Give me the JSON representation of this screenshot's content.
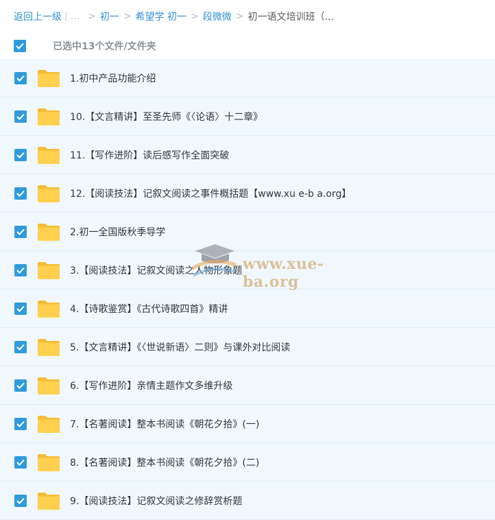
{
  "breadcrumb": {
    "back": "返回上一级",
    "ellipsis": "...",
    "items": [
      "初一",
      "希望学 初一",
      "段微微"
    ],
    "current": "初一语文培训班（..."
  },
  "selection": {
    "label": "已选中13个文件/文件夹"
  },
  "files": [
    {
      "name": "1.初中产品功能介绍"
    },
    {
      "name": "10.【文言精讲】至圣先师《〈论语〉十二章》"
    },
    {
      "name": "11.【写作进阶】读后感写作全面突破"
    },
    {
      "name": "12.【阅读技法】记叙文阅读之事件概括题【www.xu e-b a.org】"
    },
    {
      "name": "2.初一全国版秋季导学"
    },
    {
      "name": "3.【阅读技法】记叙文阅读之人物形象题"
    },
    {
      "name": "4.【诗歌鉴赏】《古代诗歌四首》精讲"
    },
    {
      "name": "5.【文言精讲】《〈世说新语〉二则》与课外对比阅读"
    },
    {
      "name": "6.【写作进阶】亲情主题作文多维升级"
    },
    {
      "name": "7.【名著阅读】整本书阅读《朝花夕拾》(一)"
    },
    {
      "name": "8.【名著阅读】整本书阅读《朝花夕拾》(二)"
    },
    {
      "name": "9.【阅读技法】记叙文阅读之修辞赏析题"
    }
  ],
  "watermark": {
    "text": "www.xue-ba.org"
  },
  "colors": {
    "accent": "#2f9bdc",
    "link": "#2f8fd4",
    "row_bg": "#f1f8fd",
    "folder": "#ffd04f"
  }
}
